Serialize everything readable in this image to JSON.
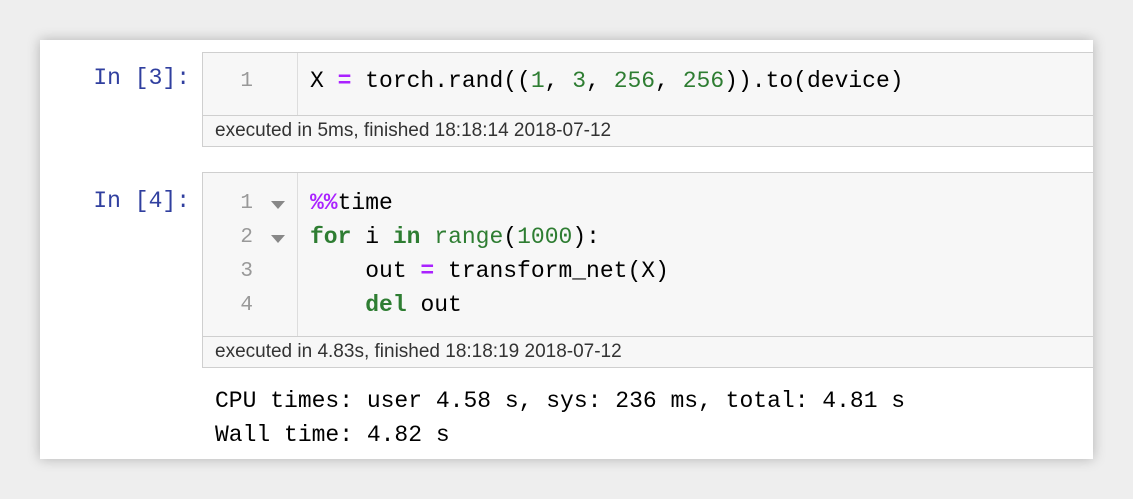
{
  "cells": [
    {
      "prompt": "In [3]:",
      "lines": [
        {
          "number": "1",
          "parts": [
            "X ",
            "=",
            " torch.rand((",
            "1",
            ", ",
            "3",
            ", ",
            "256",
            ", ",
            "256",
            ")).to(device)"
          ]
        }
      ],
      "execution": "executed in 5ms, finished 18:18:14 2018-07-12"
    },
    {
      "prompt": "In [4]:",
      "lines": [
        {
          "number": "1",
          "parts": [
            "%%",
            "time"
          ]
        },
        {
          "number": "2",
          "parts": [
            "for",
            " i ",
            "in",
            " ",
            "range",
            "(",
            "1000",
            "):"
          ]
        },
        {
          "number": "3",
          "parts": [
            "    out ",
            "=",
            " transform_net(X)"
          ]
        },
        {
          "number": "4",
          "parts": [
            "    ",
            "del",
            " out"
          ]
        }
      ],
      "execution": "executed in 4.83s, finished 18:18:19 2018-07-12",
      "output": [
        "CPU times: user 4.58 s, sys: 236 ms, total: 4.81 s",
        "Wall time: 4.82 s"
      ]
    }
  ],
  "colors": {
    "prompt": "#303f9f",
    "keyword": "#2e7d32",
    "operator": "#aa22ff",
    "number": "#2e7d32"
  }
}
